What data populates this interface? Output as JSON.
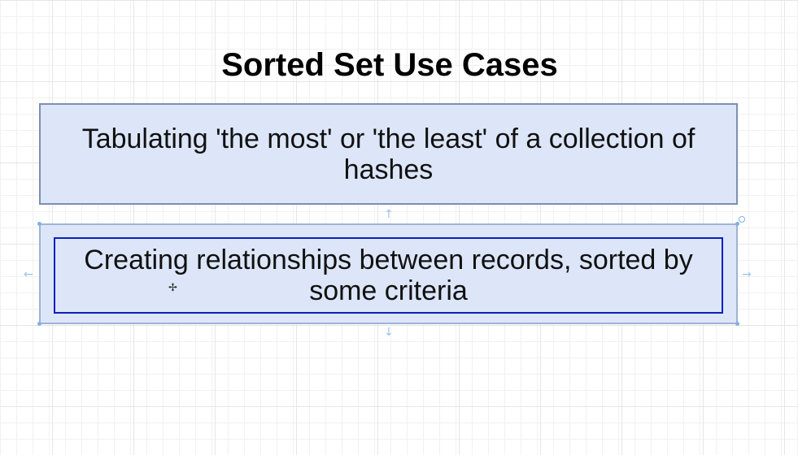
{
  "title": "Sorted Set Use Cases",
  "cards": [
    {
      "text": "Tabulating 'the most' or 'the least' of a collection of hashes"
    },
    {
      "text": "Creating relationships between records, sorted by some criteria"
    }
  ],
  "colors": {
    "card_fill": "#dce6f8",
    "card_border": "#7d8fb3",
    "selection_border": "#0b1fbf",
    "handle": "#7fb1e3"
  },
  "icons": {
    "arrow_up": "arrow-up-icon",
    "arrow_down": "arrow-down-icon",
    "arrow_left": "arrow-left-icon",
    "arrow_right": "arrow-right-icon",
    "cursor": "move-cursor-icon"
  }
}
